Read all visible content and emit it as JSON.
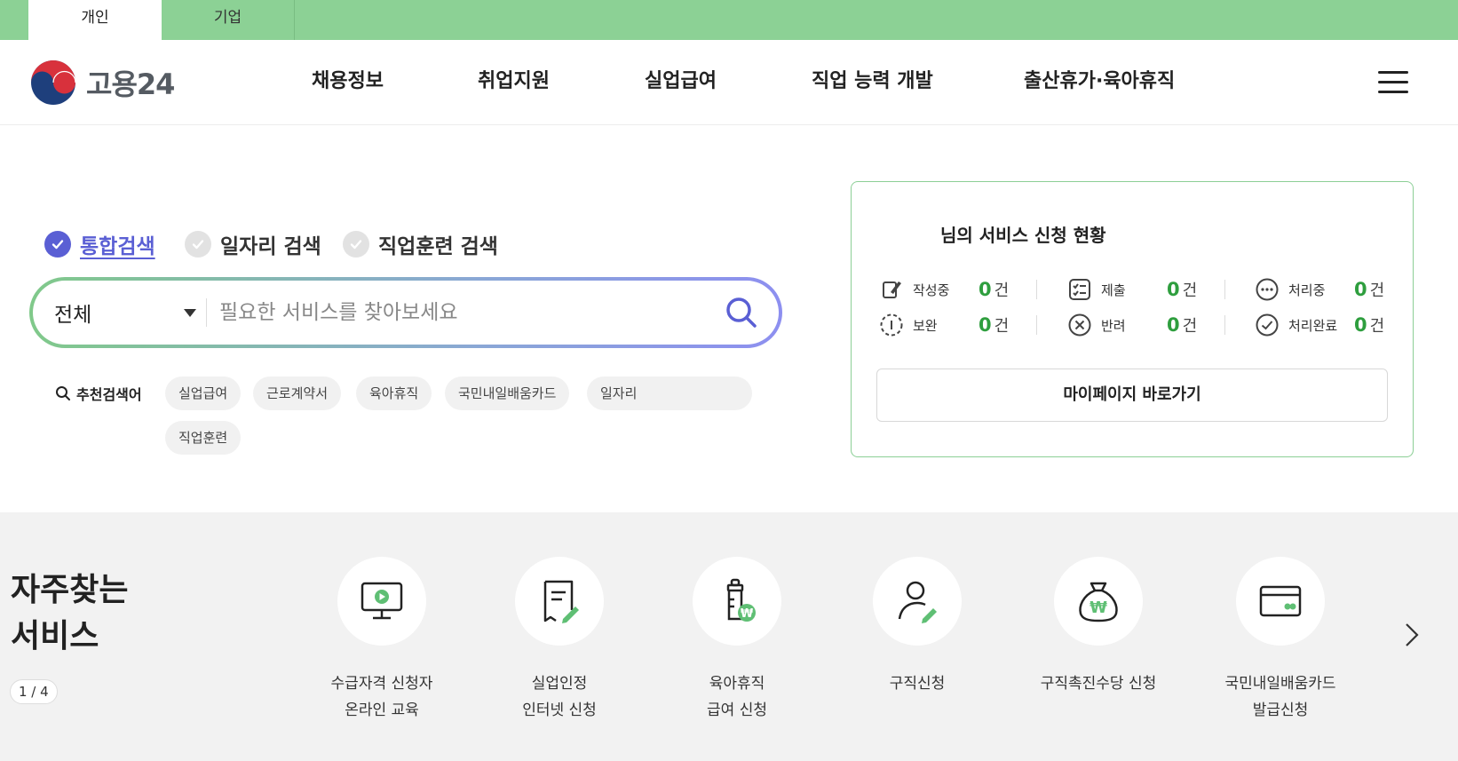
{
  "audience_tabs": [
    {
      "label": "개인",
      "active": true
    },
    {
      "label": "기업",
      "active": false
    }
  ],
  "logo": {
    "text": "고용24"
  },
  "gnb": [
    "채용정보",
    "취업지원",
    "실업급여",
    "직업 능력 개발",
    "출산휴가·육아휴직"
  ],
  "search": {
    "types": [
      {
        "label": "통합검색",
        "active": true
      },
      {
        "label": "일자리 검색",
        "active": false
      },
      {
        "label": "직업훈련 검색",
        "active": false
      }
    ],
    "scope": "전체",
    "placeholder": "필요한 서비스를 찾아보세요",
    "value": "",
    "recommend_label": "추천검색어",
    "keywords": [
      "실업급여",
      "근로계약서",
      "육아휴직",
      "국민내일배움카드",
      "일자리",
      "직업훈련"
    ]
  },
  "status": {
    "title": "님의 서비스 신청 현황",
    "items": [
      {
        "label": "작성중",
        "count": "0",
        "unit": "건",
        "icon": "pen-paper-icon"
      },
      {
        "label": "제출",
        "count": "0",
        "unit": "건",
        "icon": "checklist-icon"
      },
      {
        "label": "처리중",
        "count": "0",
        "unit": "건",
        "icon": "dots-circle-icon"
      },
      {
        "label": "보완",
        "count": "0",
        "unit": "건",
        "icon": "dashed-circle-icon"
      },
      {
        "label": "반려",
        "count": "0",
        "unit": "건",
        "icon": "x-circle-icon"
      },
      {
        "label": "처리완료",
        "count": "0",
        "unit": "건",
        "icon": "check-circle-icon"
      }
    ],
    "mypage_button": "마이페이지 바로가기"
  },
  "frequent": {
    "title_line1": "자주찾는",
    "title_line2": "서비스",
    "pager": "1 / 4",
    "services": [
      {
        "line1": "수급자격 신청자",
        "line2": "온라인 교육",
        "icon": "monitor-play-icon"
      },
      {
        "line1": "실업인정",
        "line2": "인터넷 신청",
        "icon": "document-pen-icon"
      },
      {
        "line1": "육아휴직",
        "line2": "급여 신청",
        "icon": "baby-bottle-won-icon"
      },
      {
        "line1": "구직신청",
        "line2": "",
        "icon": "person-pen-icon"
      },
      {
        "line1": "구직촉진수당 신청",
        "line2": "",
        "icon": "money-bag-icon"
      },
      {
        "line1": "국민내일배움카드",
        "line2": "발급신청",
        "icon": "card-icon"
      }
    ]
  },
  "colors": {
    "brand_green": "#8cd195",
    "accent_purple": "#5a5fd4",
    "count_green": "#2e9e3e"
  }
}
